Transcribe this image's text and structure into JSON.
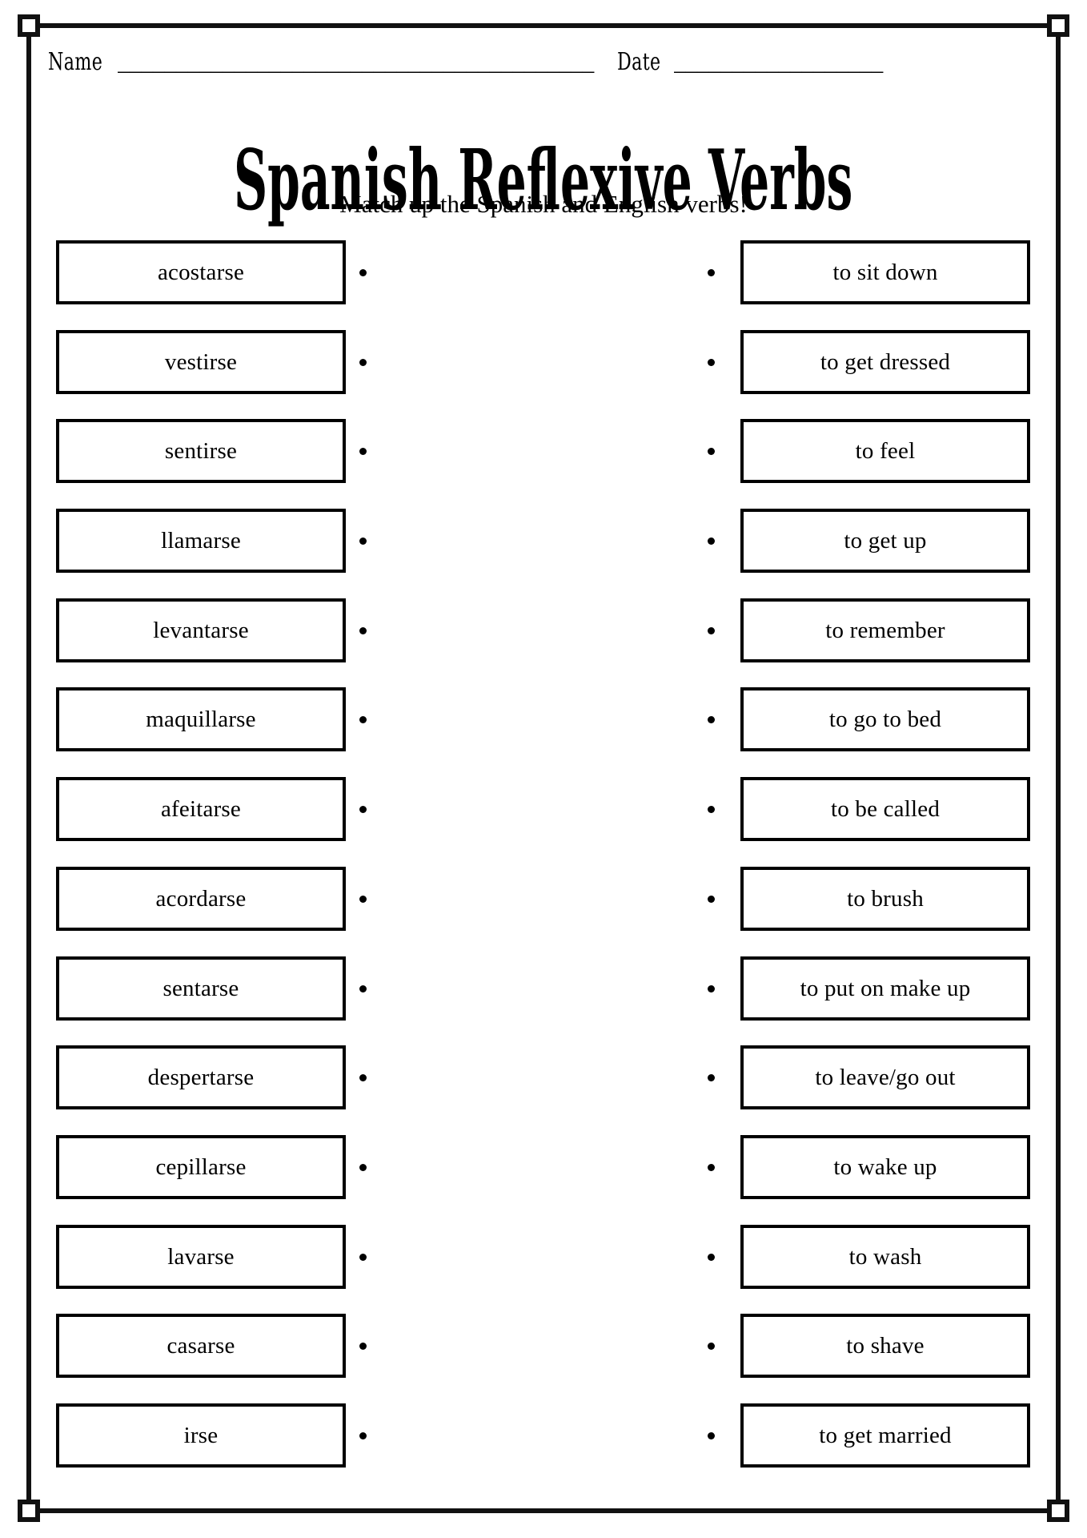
{
  "header": {
    "name_label": "Name",
    "name_rule": "_________________________________________",
    "date_label": "Date",
    "date_rule": "__________________"
  },
  "title": "Spanish Reflexive Verbs",
  "subtitle": "Match up the Spanish and English verbs!",
  "colors": {
    "ink": "#000000",
    "frame": "#111111",
    "paper": "#ffffff"
  },
  "matching": {
    "rows": [
      {
        "spanish": "acostarse",
        "english": "to sit down"
      },
      {
        "spanish": "vestirse",
        "english": "to get dressed"
      },
      {
        "spanish": "sentirse",
        "english": "to feel"
      },
      {
        "spanish": "llamarse",
        "english": "to get up"
      },
      {
        "spanish": "levantarse",
        "english": "to remember"
      },
      {
        "spanish": "maquillarse",
        "english": "to go to bed"
      },
      {
        "spanish": "afeitarse",
        "english": "to be called"
      },
      {
        "spanish": "acordarse",
        "english": "to brush"
      },
      {
        "spanish": "sentarse",
        "english": "to put on make up"
      },
      {
        "spanish": "despertarse",
        "english": "to leave/go out"
      },
      {
        "spanish": "cepillarse",
        "english": "to wake up"
      },
      {
        "spanish": "lavarse",
        "english": "to wash"
      },
      {
        "spanish": "casarse",
        "english": "to shave"
      },
      {
        "spanish": "irse",
        "english": "to get married"
      }
    ]
  }
}
